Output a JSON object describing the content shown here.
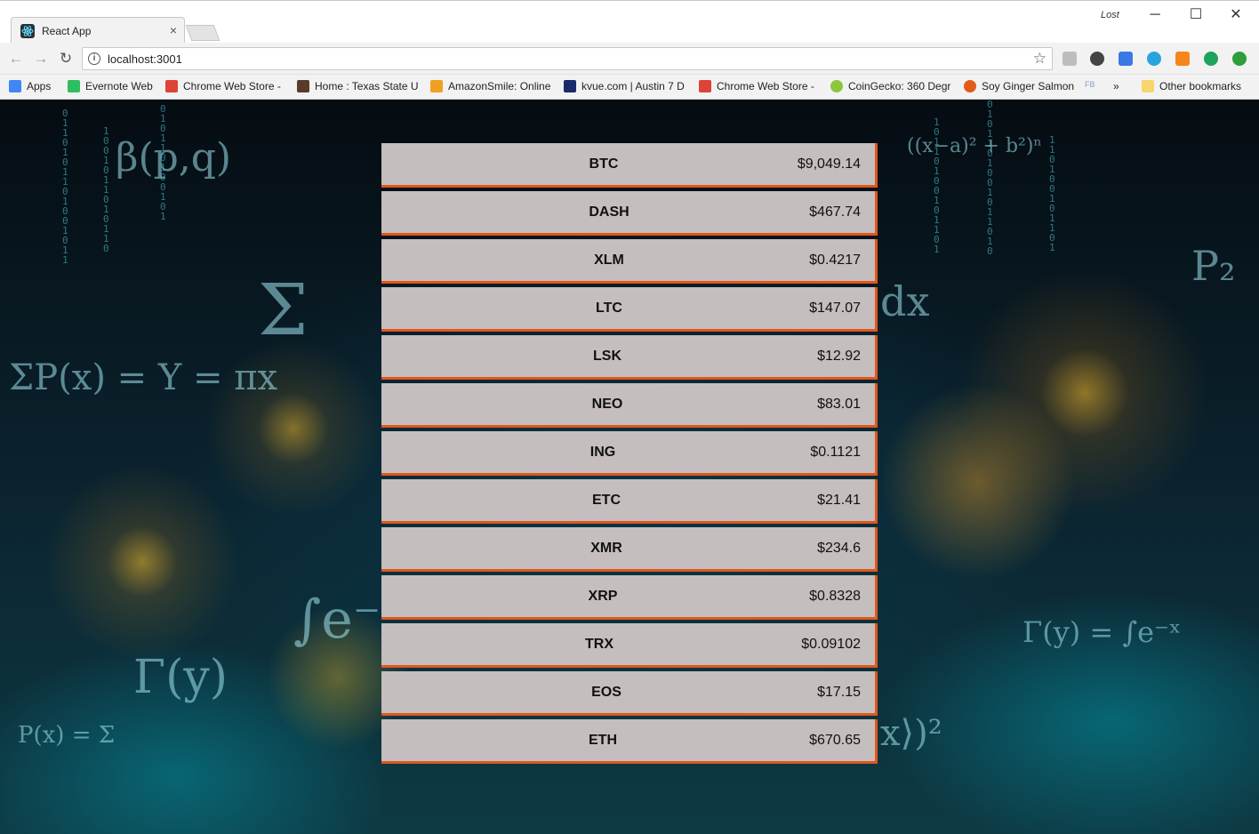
{
  "window": {
    "tab_title": "React App",
    "user_label": "Lost",
    "controls": {
      "minimize": "─",
      "maximize": "☐",
      "close": "✕"
    }
  },
  "toolbar": {
    "url": "localhost:3001"
  },
  "bookmarks": [
    {
      "label": "Apps",
      "color": "#4285f4"
    },
    {
      "label": "Evernote Web",
      "color": "#2dbe60"
    },
    {
      "label": "Chrome Web Store -",
      "color": "#db4437"
    },
    {
      "label": "Home : Texas State U",
      "color": "#5a3b2a"
    },
    {
      "label": "AmazonSmile: Online",
      "color": "#f0a020"
    },
    {
      "label": "kvue.com | Austin 7 D",
      "color": "#1a2a6c"
    },
    {
      "label": "Chrome Web Store -",
      "color": "#db4437"
    },
    {
      "label": "CoinGecko: 360 Degr",
      "color": "#8dc63f"
    },
    {
      "label": "Soy Ginger Salmon",
      "color": "#e25a1c"
    },
    {
      "label": "FB",
      "color": "#8aa0c8"
    }
  ],
  "bookmarks_more": "»",
  "other_bookmarks": "Other bookmarks",
  "coins": [
    {
      "symbol": "BTC",
      "price": "$9,049.14"
    },
    {
      "symbol": "DASH",
      "price": "$467.74"
    },
    {
      "symbol": "XLM",
      "price": "$0.4217"
    },
    {
      "symbol": "LTC",
      "price": "$147.07"
    },
    {
      "symbol": "LSK",
      "price": "$12.92"
    },
    {
      "symbol": "NEO",
      "price": "$83.01"
    },
    {
      "symbol": "ING",
      "price": "$0.1121"
    },
    {
      "symbol": "ETC",
      "price": "$21.41"
    },
    {
      "symbol": "XMR",
      "price": "$234.6"
    },
    {
      "symbol": "XRP",
      "price": "$0.8328"
    },
    {
      "symbol": "TRX",
      "price": "$0.09102"
    },
    {
      "symbol": "EOS",
      "price": "$17.15"
    },
    {
      "symbol": "ETH",
      "price": "$670.65"
    }
  ],
  "colors": {
    "row_bg": "#c4bebe",
    "row_accent": "#e2561c"
  }
}
